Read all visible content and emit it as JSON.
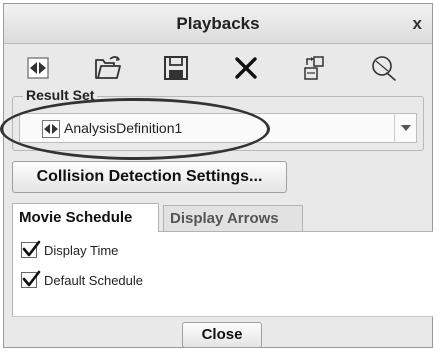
{
  "window": {
    "title": "Playbacks",
    "close_glyph": "x"
  },
  "toolbar": {
    "buttons": [
      {
        "name": "result-set-arrows-icon"
      },
      {
        "name": "open-folder-icon"
      },
      {
        "name": "save-disk-icon"
      },
      {
        "name": "delete-x-icon"
      },
      {
        "name": "export-icon"
      },
      {
        "name": "balloon-icon"
      }
    ]
  },
  "result_set": {
    "label": "Result Set",
    "value": "AnalysisDefinition1",
    "icon": "result-set-arrows-icon",
    "dropdown_icon": "chevron-down-icon"
  },
  "buttons": {
    "collision_detection": "Collision Detection Settings...",
    "close": "Close"
  },
  "tabs": [
    {
      "label": "Movie Schedule",
      "active": true
    },
    {
      "label": "Display Arrows",
      "active": false
    }
  ],
  "checkboxes": [
    {
      "label": "Display Time",
      "checked": true
    },
    {
      "label": "Default Schedule",
      "checked": true
    }
  ],
  "colors": {
    "dialog_bg": "#e9e9e9",
    "panel_bg": "#ffffff",
    "annotation_ellipse": "#333333"
  }
}
